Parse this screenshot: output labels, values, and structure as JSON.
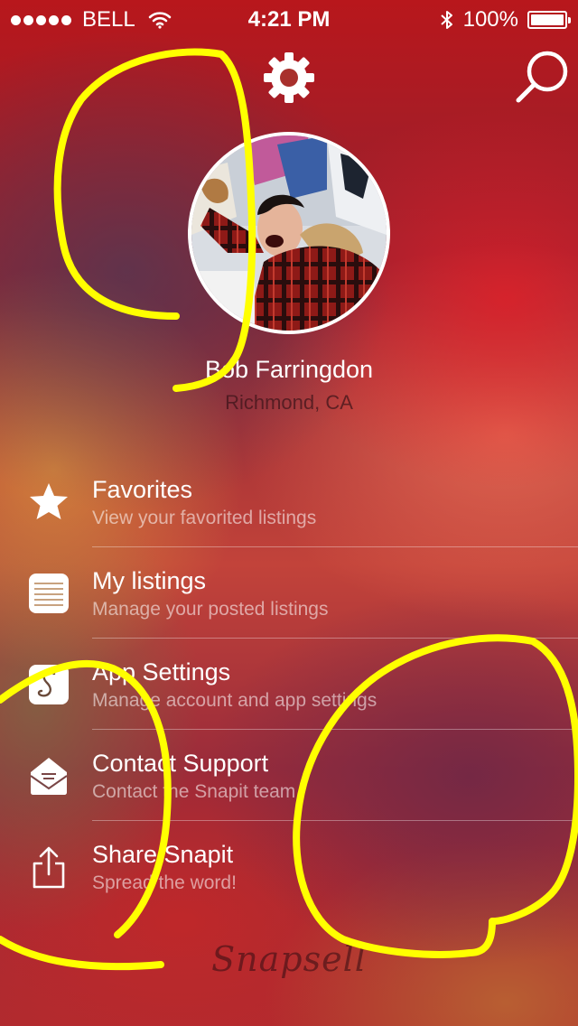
{
  "status_bar": {
    "carrier": "BELL",
    "time": "4:21 PM",
    "battery": "100%",
    "battery_level": 1.0
  },
  "header": {
    "settings_icon": "gear-icon",
    "search_icon": "search-icon"
  },
  "profile": {
    "name": "Bob Farringdon",
    "location": "Richmond, CA"
  },
  "menu": {
    "items": [
      {
        "title": "Favorites",
        "subtitle": "View your favorited listings",
        "icon": "star-icon"
      },
      {
        "title": "My listings",
        "subtitle": "Manage your posted listings",
        "icon": "list-icon"
      },
      {
        "title": "App Settings",
        "subtitle": "Manage account and app settings",
        "icon": "app-logo-icon"
      },
      {
        "title": "Contact Support",
        "subtitle": "Contact the Snapit team",
        "icon": "envelope-icon"
      },
      {
        "title": "Share Snapit",
        "subtitle": "Spread the word!",
        "icon": "share-icon"
      }
    ]
  },
  "footer": {
    "logo_text": "Snapsell"
  },
  "colors": {
    "annotation": "#ffff00",
    "text_primary": "#ffffff"
  }
}
